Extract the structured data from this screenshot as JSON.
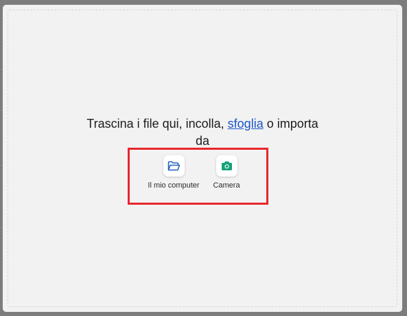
{
  "dropzone": {
    "prompt_before": "Trascina i file qui, incolla, ",
    "browse_link": "sfoglia",
    "prompt_after": " o importa",
    "prompt_line2": "da"
  },
  "sources": [
    {
      "label": "Il mio computer",
      "icon": "folder-open-icon",
      "color": "#1f5fbf"
    },
    {
      "label": "Camera",
      "icon": "camera-icon",
      "color": "#17a27a"
    }
  ],
  "colors": {
    "highlight": "#e8262a",
    "link": "#1a56c9"
  }
}
